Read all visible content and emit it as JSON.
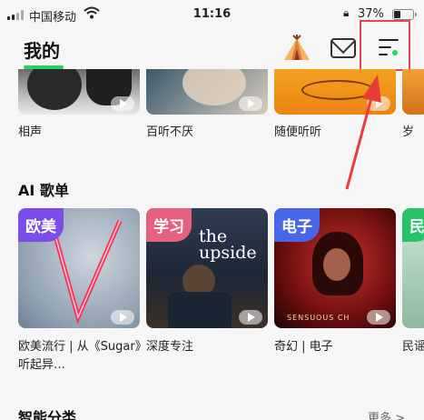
{
  "status_bar": {
    "carrier": "中国移动",
    "time": "11:16",
    "battery_percent_text": "37%",
    "battery_level": 0.37,
    "icons": [
      "signal-icon",
      "wifi-icon",
      "orientation-lock-icon",
      "battery-icon"
    ]
  },
  "header": {
    "title": "我的",
    "icons": [
      "tent-icon",
      "mail-icon",
      "menu-icon"
    ]
  },
  "top_row": [
    {
      "label": "相声"
    },
    {
      "label": "百听不厌"
    },
    {
      "label": "随便听听"
    },
    {
      "label": "岁"
    }
  ],
  "ai_section": {
    "title": "AI 歌单",
    "cards": [
      {
        "tag": "欧美",
        "label": "欧美流行 | 从《Sugar》听起异…"
      },
      {
        "tag": "学习",
        "label": "深度专注",
        "cover_text_top": "the upside"
      },
      {
        "tag": "电子",
        "label": "奇幻 | 电子",
        "cover_text_bottom": "SENSUOUS CH"
      },
      {
        "tag": "民",
        "label": "民谣"
      }
    ]
  },
  "smart_section": {
    "title": "智能分类",
    "more": "更多 >"
  },
  "colors": {
    "accent_green": "#1ed760",
    "highlight_red": "#e0484b",
    "tag_purple": "#7b4ee8",
    "tag_pink": "#e7607d",
    "tag_blue": "#4766e8",
    "tag_green": "#27c36b"
  }
}
